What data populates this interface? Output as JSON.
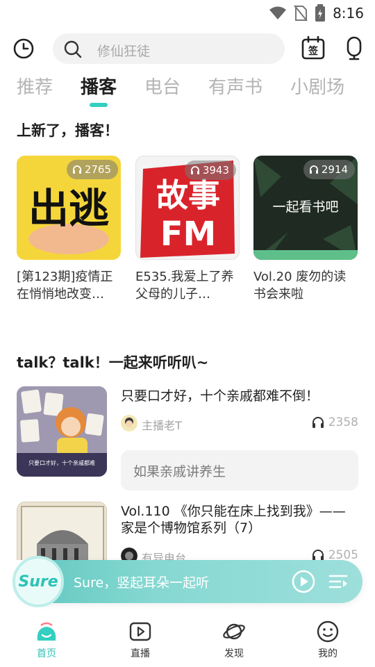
{
  "status_bar": {
    "time": "8:16"
  },
  "search": {
    "placeholder": "修仙狂徒"
  },
  "header": {
    "signin_label": "签"
  },
  "tabs": [
    {
      "label": "推荐",
      "active": false
    },
    {
      "label": "播客",
      "active": true
    },
    {
      "label": "电台",
      "active": false
    },
    {
      "label": "有声书",
      "active": false
    },
    {
      "label": "小剧场",
      "active": false
    }
  ],
  "new_podcasts": {
    "title": "上新了，播客！",
    "cards": [
      {
        "cover_text": "出逃",
        "plays": "2765",
        "title": "[第123期]疫情正在悄悄地改变…"
      },
      {
        "cover_text_top": "故事",
        "cover_text_bottom": "FM",
        "plays": "3943",
        "title": "E535.我爱上了养父母的儿子…"
      },
      {
        "cover_text": "一起看书吧",
        "plays": "2914",
        "title": "Vol.20 废勿的读书会来啦"
      }
    ]
  },
  "talk_section": {
    "title": "talk？talk！一起来听听叭~",
    "items": [
      {
        "title": "只要口才好，十个亲戚都难不倒！",
        "host": "主播老T",
        "plays": "2358",
        "comment": "如果亲戚讲养生",
        "thumb_caption": "只要口才好，十个亲戚都难"
      },
      {
        "title": "Vol.110 《你只能在床上找到我》——家是个博物馆系列（7）",
        "host": "有异电台",
        "plays": "2505"
      }
    ]
  },
  "player": {
    "logo": "Sure",
    "text": "Sure，竖起耳朵一起听"
  },
  "bottom_nav": [
    {
      "label": "首页",
      "icon": "home-icon",
      "active": true
    },
    {
      "label": "直播",
      "icon": "live-icon",
      "active": false
    },
    {
      "label": "发现",
      "icon": "planet-icon",
      "active": false
    },
    {
      "label": "我的",
      "icon": "profile-icon",
      "active": false
    }
  ],
  "colors": {
    "accent": "#33cfc0",
    "player": "#86d8d2",
    "text": "#1f1f1f",
    "muted": "#b4b4b4"
  }
}
